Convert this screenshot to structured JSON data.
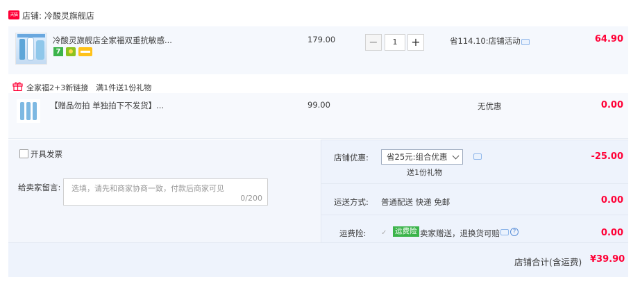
{
  "shop": {
    "badge": "天猫",
    "name": "店铺: 冷酸灵旗舰店"
  },
  "item1": {
    "title": "冷酸灵旗舰店全家福双重抗敏感...",
    "badge_num": "7",
    "price": "179.00",
    "quantity": "1",
    "minus": "−",
    "plus": "+",
    "promo": "省114.10:店铺活动",
    "total": "64.90"
  },
  "gift_group": {
    "label": "全家福2+3新链接　满1件送1份礼物"
  },
  "item2": {
    "title": "【赠品勿拍 单独拍下不发货】...",
    "price": "99.00",
    "promo": "无优惠",
    "total": "0.00"
  },
  "invoice": {
    "label": "开具发票"
  },
  "message": {
    "label": "给卖家留言:",
    "placeholder": "选填，请先和商家协商一致，付款后商家可见",
    "count": "0/200"
  },
  "discount": {
    "label": "店铺优惠:",
    "selected": "省25元:组合优惠",
    "sub": "送1份礼物",
    "amount": "-25.00"
  },
  "shipping": {
    "label": "运送方式:",
    "value": "普通配送 快递 免邮",
    "amount": "0.00"
  },
  "insurance": {
    "label": "运费险:",
    "badge": "运费险",
    "text": "卖家赠送，退换货可赔",
    "amount": "0.00",
    "check": "✓",
    "help": "?"
  },
  "summary": {
    "label": "店铺合计(含运费)",
    "amount": "¥39.90"
  },
  "colors": {
    "accent_red": "#ff0036",
    "tmall_red": "#ff0036",
    "green_badge": "#3cb44b",
    "panel_blue": "#eef3fc"
  }
}
